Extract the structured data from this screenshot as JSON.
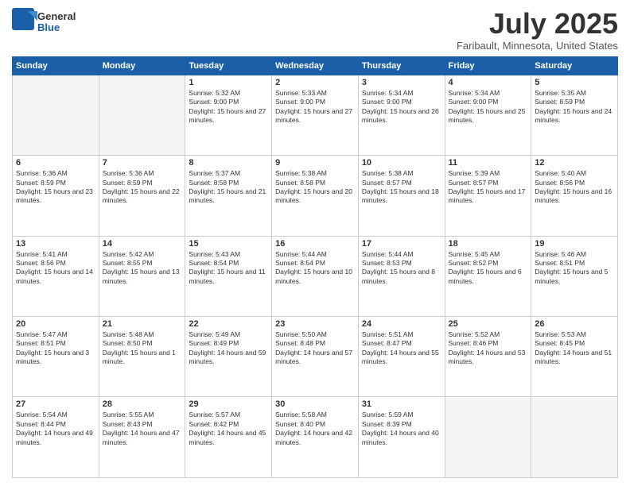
{
  "header": {
    "logo": {
      "general": "General",
      "blue": "Blue"
    },
    "title": "July 2025",
    "location": "Faribault, Minnesota, United States"
  },
  "days_of_week": [
    "Sunday",
    "Monday",
    "Tuesday",
    "Wednesday",
    "Thursday",
    "Friday",
    "Saturday"
  ],
  "weeks": [
    [
      {
        "day": "",
        "sunrise": "",
        "sunset": "",
        "daylight": ""
      },
      {
        "day": "",
        "sunrise": "",
        "sunset": "",
        "daylight": ""
      },
      {
        "day": "1",
        "sunrise": "Sunrise: 5:32 AM",
        "sunset": "Sunset: 9:00 PM",
        "daylight": "Daylight: 15 hours and 27 minutes."
      },
      {
        "day": "2",
        "sunrise": "Sunrise: 5:33 AM",
        "sunset": "Sunset: 9:00 PM",
        "daylight": "Daylight: 15 hours and 27 minutes."
      },
      {
        "day": "3",
        "sunrise": "Sunrise: 5:34 AM",
        "sunset": "Sunset: 9:00 PM",
        "daylight": "Daylight: 15 hours and 26 minutes."
      },
      {
        "day": "4",
        "sunrise": "Sunrise: 5:34 AM",
        "sunset": "Sunset: 9:00 PM",
        "daylight": "Daylight: 15 hours and 25 minutes."
      },
      {
        "day": "5",
        "sunrise": "Sunrise: 5:35 AM",
        "sunset": "Sunset: 8:59 PM",
        "daylight": "Daylight: 15 hours and 24 minutes."
      }
    ],
    [
      {
        "day": "6",
        "sunrise": "Sunrise: 5:36 AM",
        "sunset": "Sunset: 8:59 PM",
        "daylight": "Daylight: 15 hours and 23 minutes."
      },
      {
        "day": "7",
        "sunrise": "Sunrise: 5:36 AM",
        "sunset": "Sunset: 8:59 PM",
        "daylight": "Daylight: 15 hours and 22 minutes."
      },
      {
        "day": "8",
        "sunrise": "Sunrise: 5:37 AM",
        "sunset": "Sunset: 8:58 PM",
        "daylight": "Daylight: 15 hours and 21 minutes."
      },
      {
        "day": "9",
        "sunrise": "Sunrise: 5:38 AM",
        "sunset": "Sunset: 8:58 PM",
        "daylight": "Daylight: 15 hours and 20 minutes."
      },
      {
        "day": "10",
        "sunrise": "Sunrise: 5:38 AM",
        "sunset": "Sunset: 8:57 PM",
        "daylight": "Daylight: 15 hours and 18 minutes."
      },
      {
        "day": "11",
        "sunrise": "Sunrise: 5:39 AM",
        "sunset": "Sunset: 8:57 PM",
        "daylight": "Daylight: 15 hours and 17 minutes."
      },
      {
        "day": "12",
        "sunrise": "Sunrise: 5:40 AM",
        "sunset": "Sunset: 8:56 PM",
        "daylight": "Daylight: 15 hours and 16 minutes."
      }
    ],
    [
      {
        "day": "13",
        "sunrise": "Sunrise: 5:41 AM",
        "sunset": "Sunset: 8:56 PM",
        "daylight": "Daylight: 15 hours and 14 minutes."
      },
      {
        "day": "14",
        "sunrise": "Sunrise: 5:42 AM",
        "sunset": "Sunset: 8:55 PM",
        "daylight": "Daylight: 15 hours and 13 minutes."
      },
      {
        "day": "15",
        "sunrise": "Sunrise: 5:43 AM",
        "sunset": "Sunset: 8:54 PM",
        "daylight": "Daylight: 15 hours and 11 minutes."
      },
      {
        "day": "16",
        "sunrise": "Sunrise: 5:44 AM",
        "sunset": "Sunset: 8:54 PM",
        "daylight": "Daylight: 15 hours and 10 minutes."
      },
      {
        "day": "17",
        "sunrise": "Sunrise: 5:44 AM",
        "sunset": "Sunset: 8:53 PM",
        "daylight": "Daylight: 15 hours and 8 minutes."
      },
      {
        "day": "18",
        "sunrise": "Sunrise: 5:45 AM",
        "sunset": "Sunset: 8:52 PM",
        "daylight": "Daylight: 15 hours and 6 minutes."
      },
      {
        "day": "19",
        "sunrise": "Sunrise: 5:46 AM",
        "sunset": "Sunset: 8:51 PM",
        "daylight": "Daylight: 15 hours and 5 minutes."
      }
    ],
    [
      {
        "day": "20",
        "sunrise": "Sunrise: 5:47 AM",
        "sunset": "Sunset: 8:51 PM",
        "daylight": "Daylight: 15 hours and 3 minutes."
      },
      {
        "day": "21",
        "sunrise": "Sunrise: 5:48 AM",
        "sunset": "Sunset: 8:50 PM",
        "daylight": "Daylight: 15 hours and 1 minute."
      },
      {
        "day": "22",
        "sunrise": "Sunrise: 5:49 AM",
        "sunset": "Sunset: 8:49 PM",
        "daylight": "Daylight: 14 hours and 59 minutes."
      },
      {
        "day": "23",
        "sunrise": "Sunrise: 5:50 AM",
        "sunset": "Sunset: 8:48 PM",
        "daylight": "Daylight: 14 hours and 57 minutes."
      },
      {
        "day": "24",
        "sunrise": "Sunrise: 5:51 AM",
        "sunset": "Sunset: 8:47 PM",
        "daylight": "Daylight: 14 hours and 55 minutes."
      },
      {
        "day": "25",
        "sunrise": "Sunrise: 5:52 AM",
        "sunset": "Sunset: 8:46 PM",
        "daylight": "Daylight: 14 hours and 53 minutes."
      },
      {
        "day": "26",
        "sunrise": "Sunrise: 5:53 AM",
        "sunset": "Sunset: 8:45 PM",
        "daylight": "Daylight: 14 hours and 51 minutes."
      }
    ],
    [
      {
        "day": "27",
        "sunrise": "Sunrise: 5:54 AM",
        "sunset": "Sunset: 8:44 PM",
        "daylight": "Daylight: 14 hours and 49 minutes."
      },
      {
        "day": "28",
        "sunrise": "Sunrise: 5:55 AM",
        "sunset": "Sunset: 8:43 PM",
        "daylight": "Daylight: 14 hours and 47 minutes."
      },
      {
        "day": "29",
        "sunrise": "Sunrise: 5:57 AM",
        "sunset": "Sunset: 8:42 PM",
        "daylight": "Daylight: 14 hours and 45 minutes."
      },
      {
        "day": "30",
        "sunrise": "Sunrise: 5:58 AM",
        "sunset": "Sunset: 8:40 PM",
        "daylight": "Daylight: 14 hours and 42 minutes."
      },
      {
        "day": "31",
        "sunrise": "Sunrise: 5:59 AM",
        "sunset": "Sunset: 8:39 PM",
        "daylight": "Daylight: 14 hours and 40 minutes."
      },
      {
        "day": "",
        "sunrise": "",
        "sunset": "",
        "daylight": ""
      },
      {
        "day": "",
        "sunrise": "",
        "sunset": "",
        "daylight": ""
      }
    ]
  ]
}
